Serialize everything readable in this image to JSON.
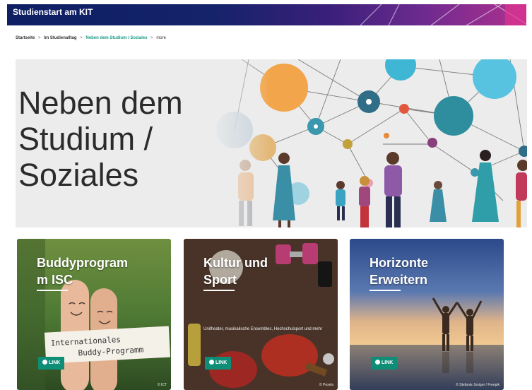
{
  "banner": {
    "title": "Studienstart am KIT"
  },
  "breadcrumb": {
    "items": [
      "Startseite",
      "Im Studienalltag",
      "Neben dem Studium / Soziales"
    ],
    "more": "more"
  },
  "hero": {
    "title_lines": [
      "Neben dem",
      "Studium /",
      "Soziales"
    ]
  },
  "tiles": [
    {
      "title_lines": [
        "Buddyprogram",
        "m ISC"
      ],
      "sign_lines": [
        "Internationales",
        "Buddy-Programm"
      ],
      "link_label": "LINK",
      "credit": "© ICT"
    },
    {
      "title_lines": [
        "Kultur und",
        "Sport"
      ],
      "description": "Unitheater, musikalische Ensembles, Hochschulsport und mehr",
      "link_label": "LINK",
      "credit": "© Pexels"
    },
    {
      "title_lines": [
        "Horizonte",
        "Erweitern"
      ],
      "link_label": "LINK",
      "credit": "© Stefanie Josiger / Freepik"
    }
  ],
  "colors": {
    "accent": "#0f8e77",
    "breadcrumb_active": "#1a9c86",
    "banner_start": "#0e1f63",
    "banner_end": "#b0318f"
  }
}
